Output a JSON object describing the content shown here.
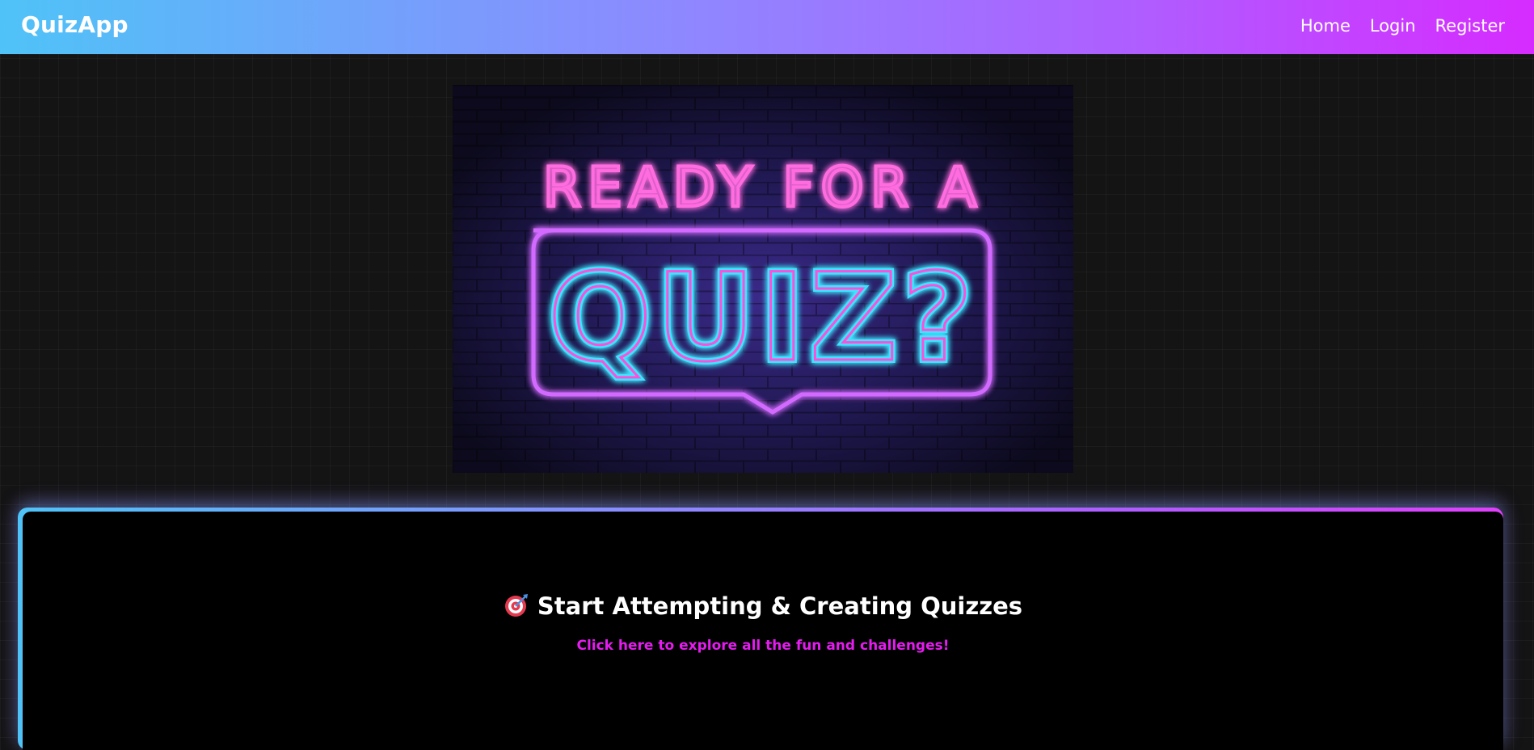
{
  "navbar": {
    "brand": "QuizApp",
    "links": [
      "Home",
      "Login",
      "Register"
    ]
  },
  "hero": {
    "line1": "READY FOR A",
    "line2": "QUIZ?",
    "colors": {
      "pink": "#ff4fd8",
      "cyan": "#3fe3ff",
      "border": "#d36bff"
    }
  },
  "cta": {
    "icon": "target-dart-icon",
    "title": "Start Attempting & Creating Quizzes",
    "subtitle": "Click here to explore all the fun and challenges!"
  },
  "colors": {
    "gradient_start": "#4fc3f7",
    "gradient_end": "#d62bff",
    "accent": "#e51cf0",
    "background": "#141414"
  }
}
